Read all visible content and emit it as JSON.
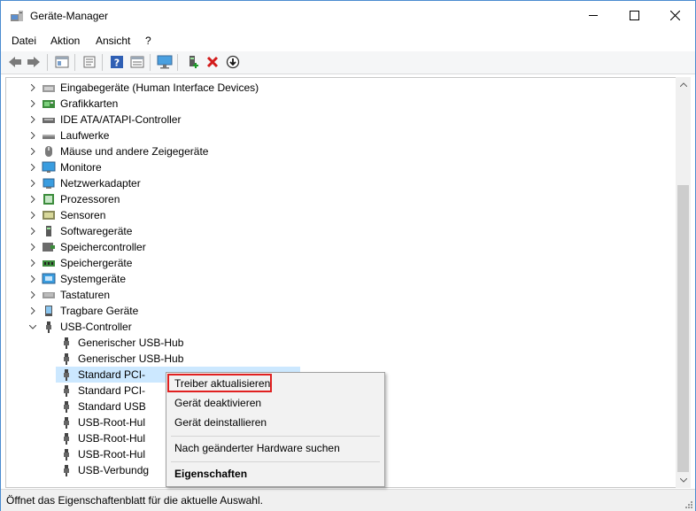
{
  "window": {
    "title": "Geräte-Manager"
  },
  "menu": [
    "Datei",
    "Aktion",
    "Ansicht",
    "?"
  ],
  "toolbar_icons": [
    "back-arrow-icon",
    "forward-arrow-icon",
    "properties-icon",
    "show-hide-icon",
    "help-icon",
    "details-icon",
    "monitor-scan-icon",
    "add-driver-icon",
    "uninstall-x-icon",
    "update-download-icon"
  ],
  "tree": {
    "items": [
      {
        "label": "Eingabegeräte (Human Interface Devices)",
        "icon": "hid-icon",
        "expanded": false
      },
      {
        "label": "Grafikkarten",
        "icon": "display-adapter-icon",
        "expanded": false
      },
      {
        "label": "IDE ATA/ATAPI-Controller",
        "icon": "ide-controller-icon",
        "expanded": false
      },
      {
        "label": "Laufwerke",
        "icon": "disk-drive-icon",
        "expanded": false
      },
      {
        "label": "Mäuse und andere Zeigegeräte",
        "icon": "mouse-icon",
        "expanded": false
      },
      {
        "label": "Monitore",
        "icon": "monitor-icon",
        "expanded": false
      },
      {
        "label": "Netzwerkadapter",
        "icon": "network-adapter-icon",
        "expanded": false
      },
      {
        "label": "Prozessoren",
        "icon": "processor-icon",
        "expanded": false
      },
      {
        "label": "Sensoren",
        "icon": "sensor-icon",
        "expanded": false
      },
      {
        "label": "Softwaregeräte",
        "icon": "software-device-icon",
        "expanded": false
      },
      {
        "label": "Speichercontroller",
        "icon": "storage-controller-icon",
        "expanded": false
      },
      {
        "label": "Speichergeräte",
        "icon": "memory-device-icon",
        "expanded": false
      },
      {
        "label": "Systemgeräte",
        "icon": "system-device-icon",
        "expanded": false
      },
      {
        "label": "Tastaturen",
        "icon": "keyboard-icon",
        "expanded": false
      },
      {
        "label": "Tragbare Geräte",
        "icon": "portable-device-icon",
        "expanded": false
      },
      {
        "label": "USB-Controller",
        "icon": "usb-icon",
        "expanded": true
      }
    ],
    "usb_children": [
      "Generischer USB-Hub",
      "Generischer USB-Hub",
      "Standard PCI-",
      "Standard PCI-",
      "Standard USB",
      "USB-Root-Hul",
      "USB-Root-Hul",
      "USB-Root-Hul",
      "USB-Verbundg"
    ],
    "selected_child_index": 2
  },
  "context_menu": {
    "update_driver": "Treiber aktualisieren",
    "disable_device": "Gerät deaktivieren",
    "uninstall_device": "Gerät deinstallieren",
    "scan_hardware": "Nach geänderter Hardware suchen",
    "properties": "Eigenschaften"
  },
  "status": {
    "text": "Öffnet das Eigenschaftenblatt für die aktuelle Auswahl."
  },
  "colors": {
    "selection": "#cce8ff",
    "highlight_border": "#e02020",
    "window_border": "#4a8bd0"
  }
}
